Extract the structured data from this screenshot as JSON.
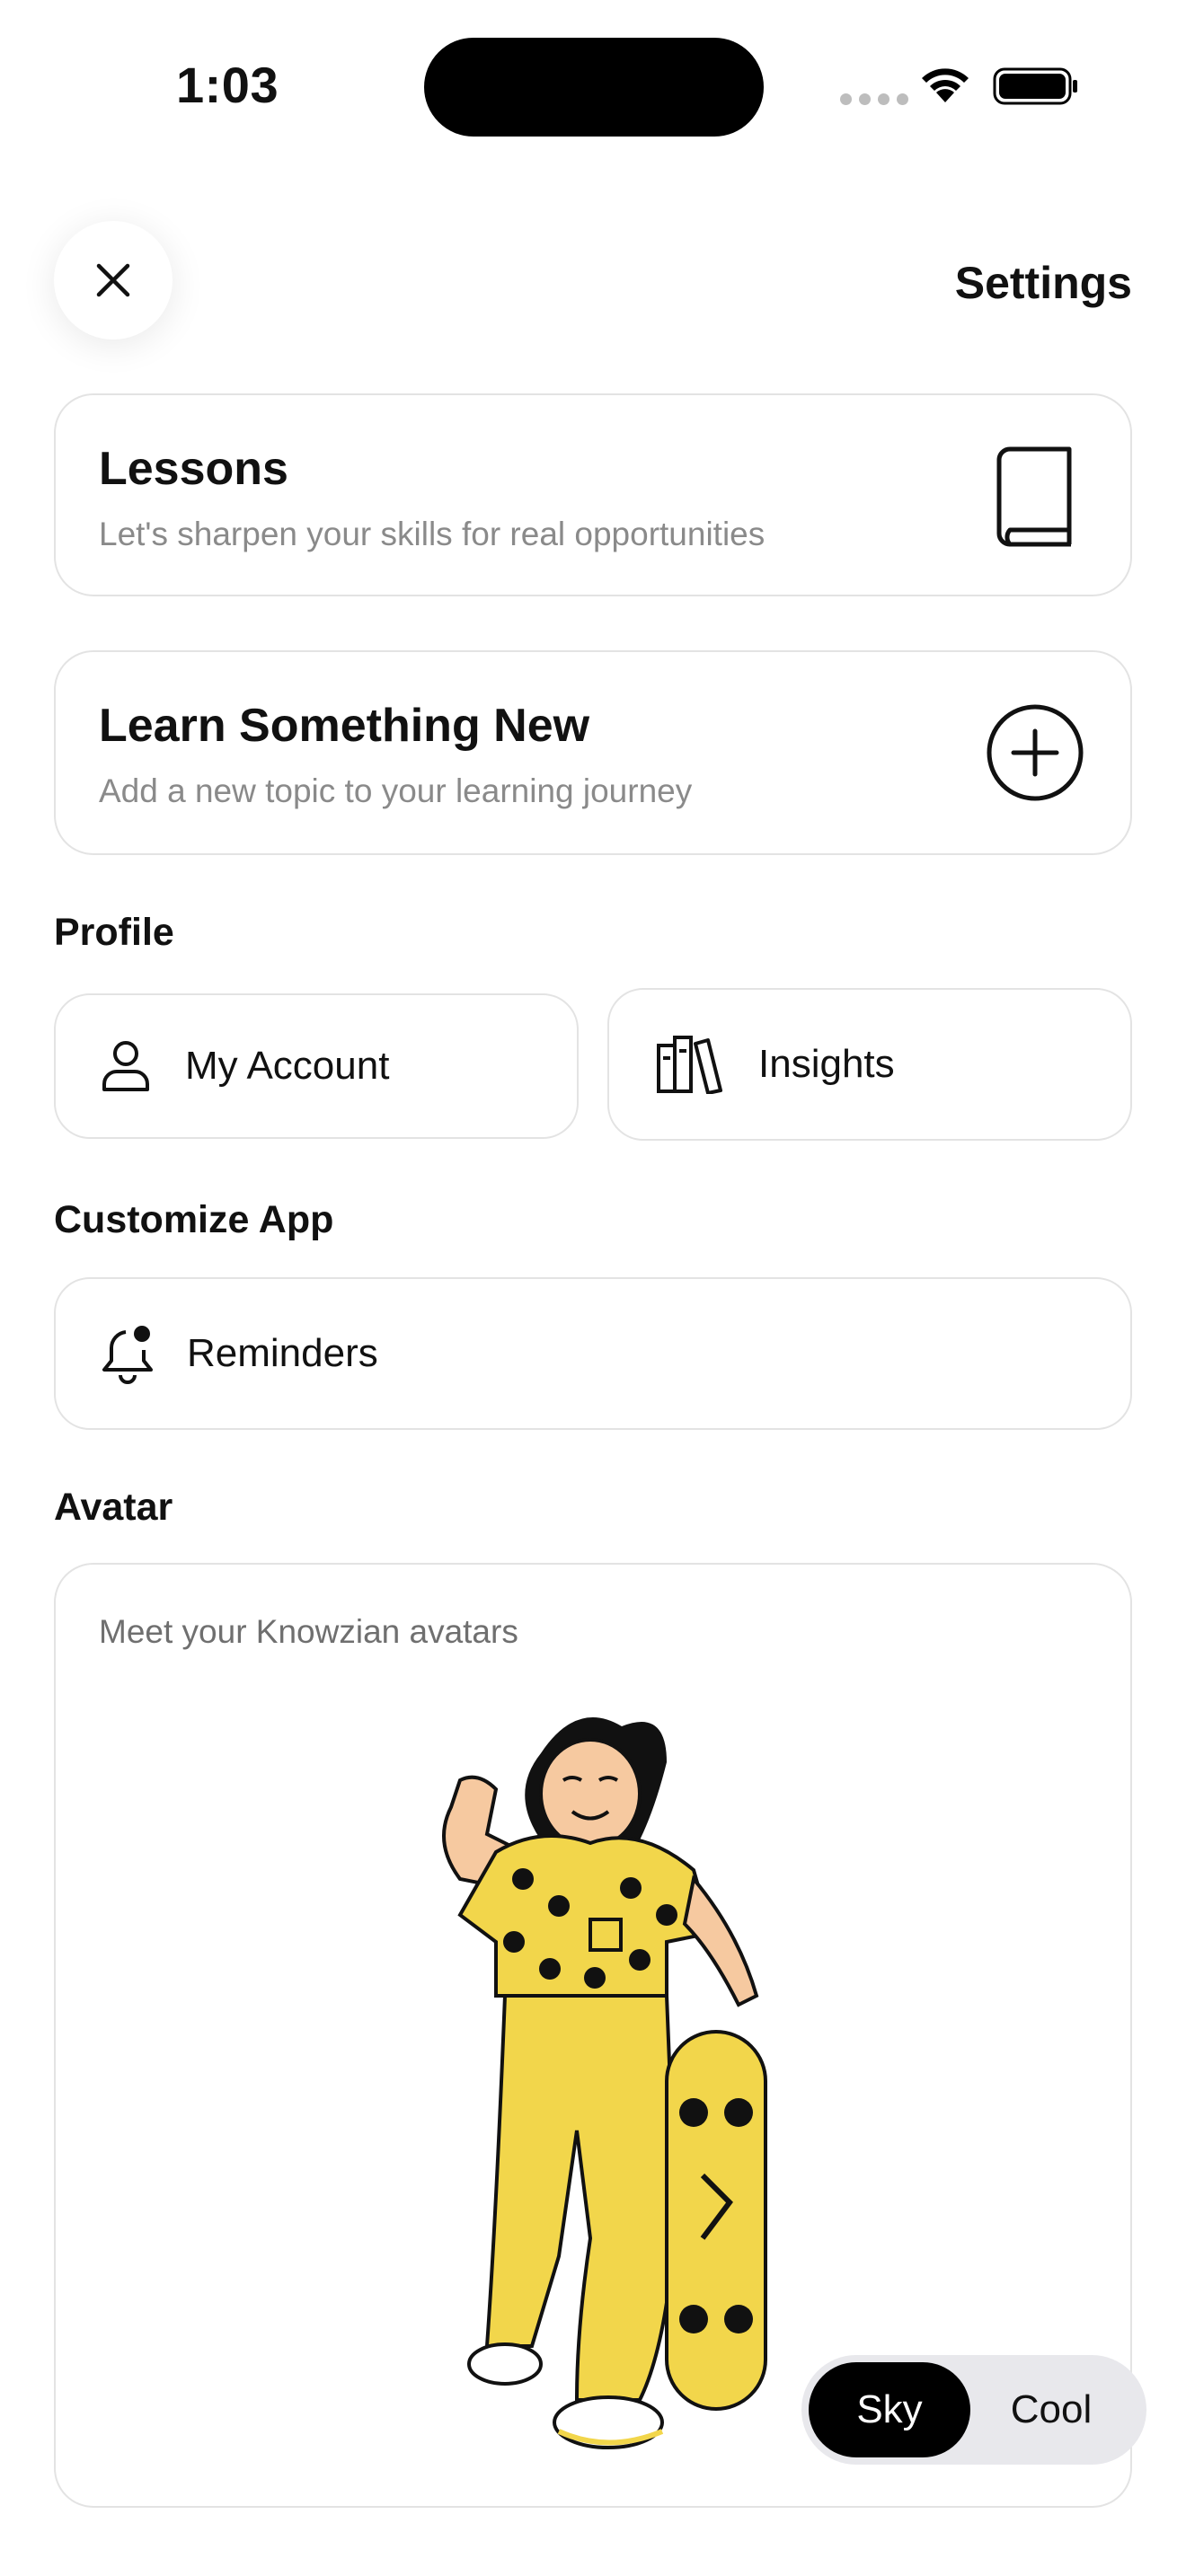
{
  "status": {
    "time": "1:03"
  },
  "header": {
    "title": "Settings"
  },
  "lessons": {
    "title": "Lessons",
    "subtitle": "Let's sharpen your skills for real opportunities",
    "icon": "book-icon"
  },
  "learn_new": {
    "title": "Learn Something New",
    "subtitle": "Add a new topic to your learning journey",
    "icon": "plus-circle-icon"
  },
  "profile": {
    "label": "Profile",
    "items": [
      {
        "label": "My Account",
        "icon": "person-icon"
      },
      {
        "label": "Insights",
        "icon": "books-icon"
      }
    ]
  },
  "customize": {
    "label": "Customize App",
    "items": [
      {
        "label": "Reminders",
        "icon": "bell-icon"
      }
    ]
  },
  "avatar": {
    "label": "Avatar",
    "caption": "Meet your Knowzian avatars",
    "toggle": {
      "options": [
        "Sky",
        "Cool"
      ],
      "selected": "Sky"
    }
  },
  "colors": {
    "accent": "#000000",
    "avatar_yellow": "#F2D64B",
    "border": "#E3E3E3"
  }
}
